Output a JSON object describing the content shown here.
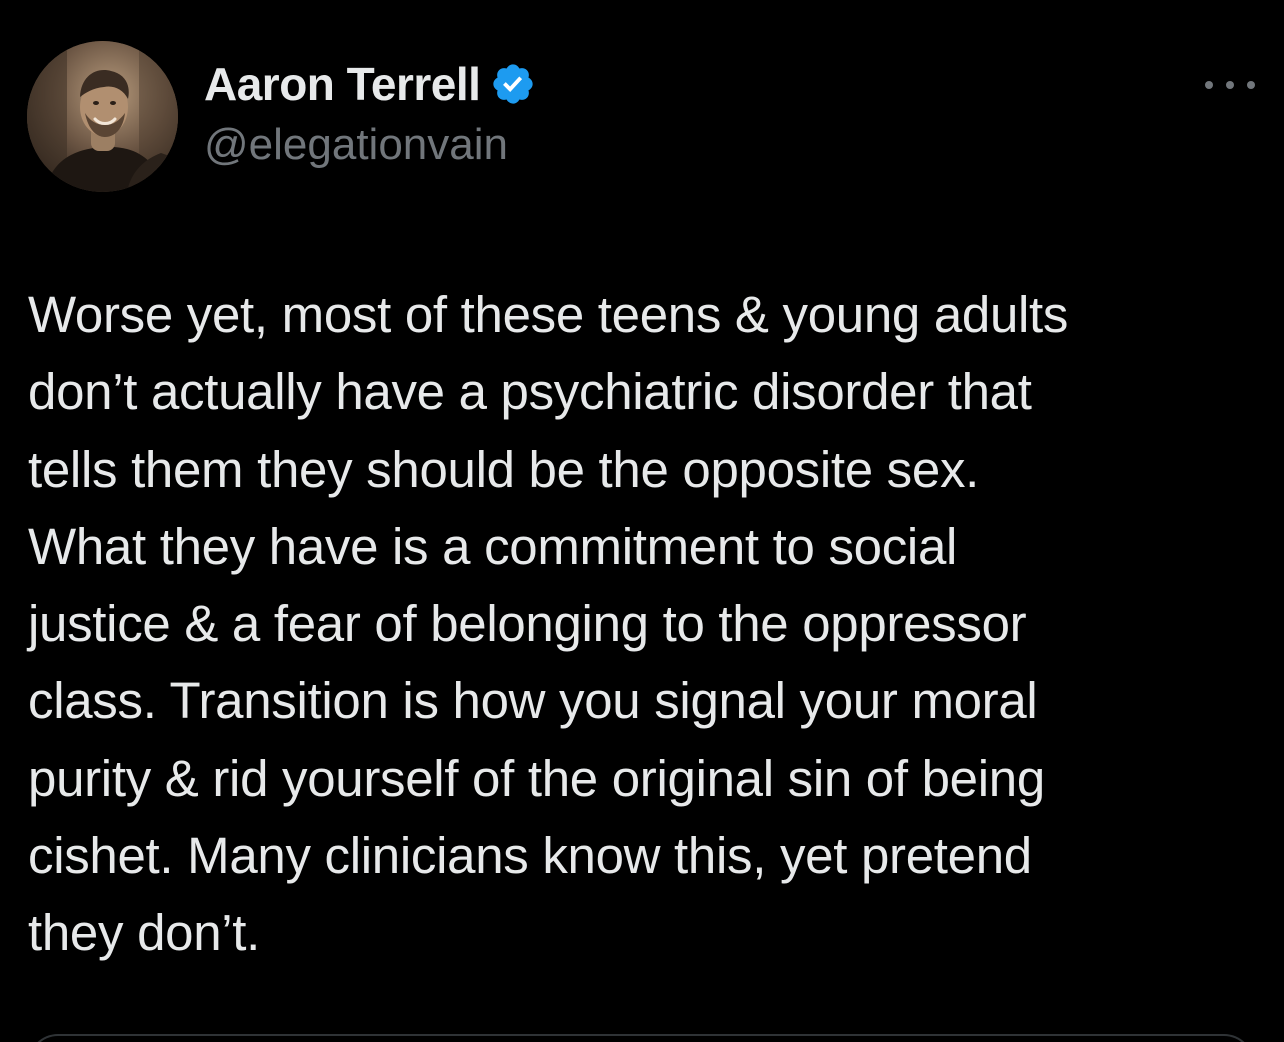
{
  "author": {
    "display_name": "Aaron Terrell",
    "handle": "@elegationvain",
    "verified": true,
    "verified_icon": "verified-badge-icon",
    "verified_color": "#1d9bf0",
    "avatar_icon": "profile-photo"
  },
  "menu": {
    "icon": "more-horizontal-icon"
  },
  "tweet": {
    "lines": [
      "Worse yet, most of these teens & young adults",
      "don’t actually have a psychiatric disorder that",
      "tells them they should be the opposite sex.",
      "What they have is a commitment to social",
      "justice & a fear of belonging to the oppressor",
      "class. Transition is how you signal your moral",
      "purity & rid yourself of the original sin of being",
      "cishet. Many clinicians know this, yet pretend",
      "they don’t."
    ]
  },
  "colors": {
    "background": "#000000",
    "text_primary": "#e7e9ea",
    "text_secondary": "#71767b",
    "border": "#2f3336",
    "accent": "#1d9bf0"
  }
}
